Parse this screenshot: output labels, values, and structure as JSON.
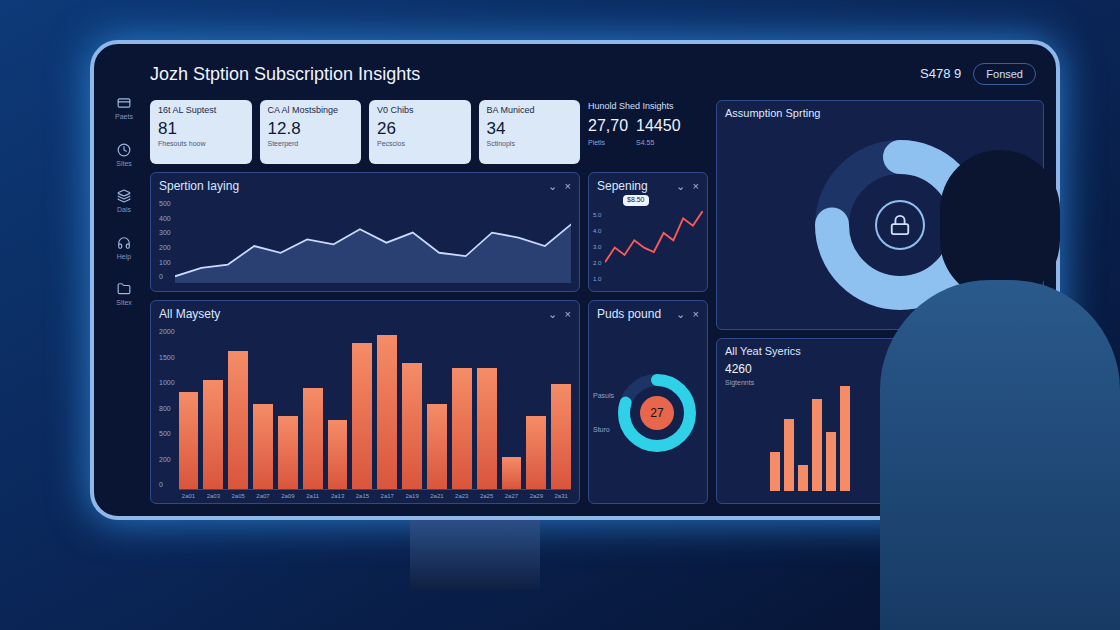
{
  "window": {
    "title": "Jozh Stption Subscription Insights",
    "reading": "S478 9",
    "pill": "Fonsed"
  },
  "controls": {
    "menu": "⌄",
    "close": "×"
  },
  "sidebar": {
    "items": [
      {
        "label": "Paets"
      },
      {
        "label": "Sites"
      },
      {
        "label": "Dais"
      },
      {
        "label": "Help"
      },
      {
        "label": "Sitex"
      }
    ]
  },
  "stat_cards": [
    {
      "label": "16t AL Suptest",
      "value": "81",
      "caption": "Fhesouts hoow"
    },
    {
      "label": "CA Al Mostsbinge",
      "value": "12.8",
      "caption": "Steerperd"
    },
    {
      "label": "V0 Chibs",
      "value": "26",
      "caption": "Pecscios"
    },
    {
      "label": "BA Municed",
      "value": "34",
      "caption": "Sctinopls"
    }
  ],
  "insights": {
    "title": "Hunold Shed Insights",
    "values": [
      {
        "value": "27,70",
        "label": "Pietls"
      },
      {
        "value": "14450",
        "label": "S4.55"
      }
    ]
  },
  "line_chart": {
    "title": "Spertion Iaying",
    "ticks": [
      "500",
      "400",
      "300",
      "200",
      "100",
      "0"
    ],
    "max": 500,
    "values": [
      40,
      90,
      110,
      220,
      180,
      260,
      230,
      320,
      240,
      300,
      180,
      160,
      300,
      270,
      220,
      350
    ]
  },
  "small_chart": {
    "title": "Sepening",
    "tooltip": "$8.50",
    "ticks": [
      "5.0",
      "4.0",
      "3.0",
      "2.0",
      "1.0"
    ],
    "max": 5,
    "values": [
      1.5,
      2.5,
      2.0,
      3.0,
      2.5,
      2.2,
      3.5,
      3.0,
      4.5,
      4.0,
      5.0
    ]
  },
  "bar_chart": {
    "title": "All Maysety",
    "ticks": [
      "2000",
      "1500",
      "1000",
      "800",
      "500",
      "200",
      "0"
    ],
    "max": 2000,
    "labels": [
      "2a01",
      "2a03",
      "2a05",
      "2a07",
      "2a09",
      "2a11",
      "2a13",
      "2a15",
      "2a17",
      "2a19",
      "2a21",
      "2a23",
      "2a25",
      "2a27",
      "2a29",
      "2a31"
    ],
    "values": [
      1200,
      1350,
      1700,
      1050,
      900,
      1250,
      850,
      1800,
      1900,
      1550,
      1050,
      1500,
      1500,
      400,
      900,
      1300
    ]
  },
  "donut_small": {
    "title": "Puds pound",
    "value": "27",
    "level": 0.8,
    "labels": [
      "Pasuls",
      "Sturo"
    ]
  },
  "donut_big": {
    "title": "Assumption Sprting",
    "level": 0.75
  },
  "side_bars": {
    "title": "All Yeat Syerics",
    "value": "4260",
    "caption": "Sigtennts",
    "values": [
      30,
      55,
      20,
      70,
      45,
      80
    ]
  }
}
